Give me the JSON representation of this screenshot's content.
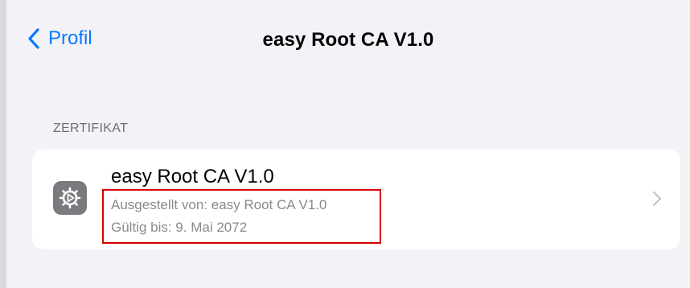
{
  "nav": {
    "back_label": "Profil",
    "title": "easy Root CA V1.0"
  },
  "section": {
    "header": "ZERTIFIKAT"
  },
  "certificate": {
    "name": "easy Root CA V1.0",
    "issued_by": "Ausgestellt von: easy Root CA V1.0",
    "valid_until": "Gültig bis: 9. Mai 2072"
  },
  "icons": {
    "back": "chevron-left-icon",
    "profile": "gear-icon",
    "disclosure": "chevron-right-icon"
  },
  "colors": {
    "accent": "#0a7aff",
    "background": "#f2f2f7",
    "highlight": "#d90000"
  }
}
